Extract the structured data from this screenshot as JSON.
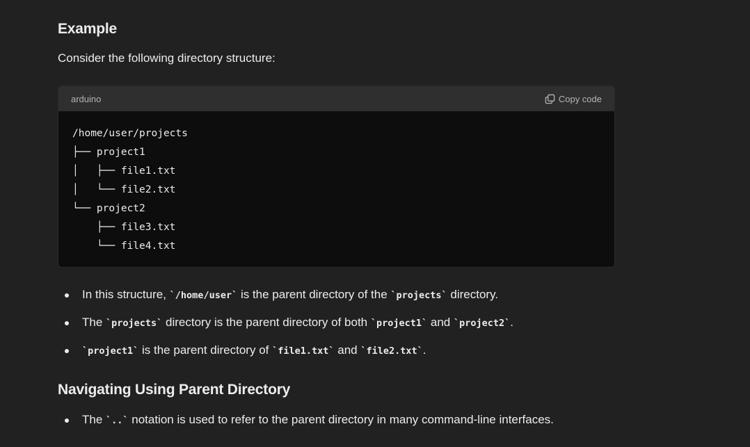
{
  "example": {
    "heading": "Example",
    "intro": "Consider the following directory structure:"
  },
  "codeblock": {
    "language": "arduino",
    "copy_label": "Copy code",
    "lines": [
      "/home/user/projects",
      "├── project1",
      "│   ├── file1.txt",
      "│   └── file2.txt",
      "└── project2",
      "    ├── file3.txt",
      "    └── file4.txt"
    ]
  },
  "bullets": [
    {
      "t1": "In this structure, ",
      "c1": "`/home/user`",
      "t2": " is the parent directory of the ",
      "c2": "`projects`",
      "t3": " directory.",
      "c3": "",
      "t4": ""
    },
    {
      "t1": "The ",
      "c1": "`projects`",
      "t2": " directory is the parent directory of both ",
      "c2": "`project1`",
      "t3": " and ",
      "c3": "`project2`",
      "t4": "."
    },
    {
      "t1": "",
      "c1": "`project1`",
      "t2": " is the parent directory of ",
      "c2": "`file1.txt`",
      "t3": " and ",
      "c3": "`file2.txt`",
      "t4": "."
    }
  ],
  "navigating": {
    "heading": "Navigating Using Parent Directory",
    "bullets": [
      {
        "t1": "The ",
        "c1": "`..`",
        "t2": " notation is used to refer to the parent directory in many command-line interfaces."
      }
    ]
  }
}
